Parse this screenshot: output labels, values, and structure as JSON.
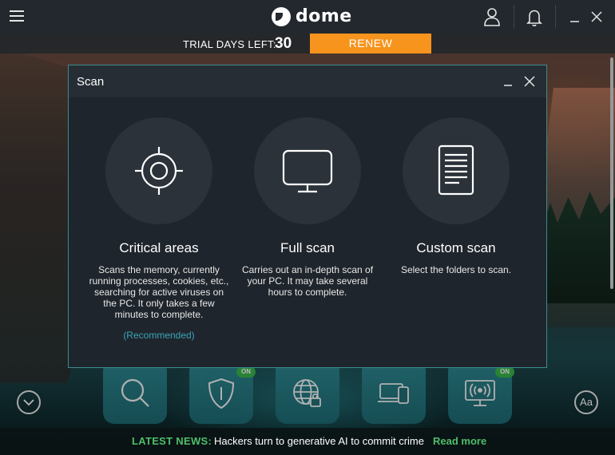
{
  "app": {
    "logo_text": "dome"
  },
  "trial": {
    "label": "TRIAL DAYS LEFT:",
    "days": "30",
    "renew_label": "RENEW"
  },
  "modal": {
    "title": "Scan",
    "options": [
      {
        "title": "Critical areas",
        "description": "Scans the memory, currently running processes, cookies, etc., searching for active viruses on the PC. It only takes a few minutes to complete.",
        "note": "(Recommended)",
        "icon": "crosshair-icon"
      },
      {
        "title": "Full scan",
        "description": "Carries out an in-depth scan of your PC. It may take several hours to complete.",
        "icon": "monitor-icon"
      },
      {
        "title": "Custom scan",
        "description": "Select the folders to scan.",
        "icon": "document-icon"
      }
    ]
  },
  "dock": {
    "items": [
      {
        "icon": "search-icon"
      },
      {
        "icon": "shield-icon",
        "badge": "ON"
      },
      {
        "icon": "globe-lock-icon"
      },
      {
        "icon": "devices-icon"
      },
      {
        "icon": "wifi-monitor-icon",
        "badge": "ON"
      }
    ]
  },
  "font_button": {
    "label": "Aa"
  },
  "news": {
    "label": "LATEST NEWS:",
    "headline": "Hackers turn to generative AI to commit crime",
    "link": "Read more"
  },
  "colors": {
    "accent_orange": "#f7941d",
    "accent_green": "#4fbe6a",
    "accent_teal": "#3aa6b9",
    "modal_bg": "#1f252c"
  }
}
